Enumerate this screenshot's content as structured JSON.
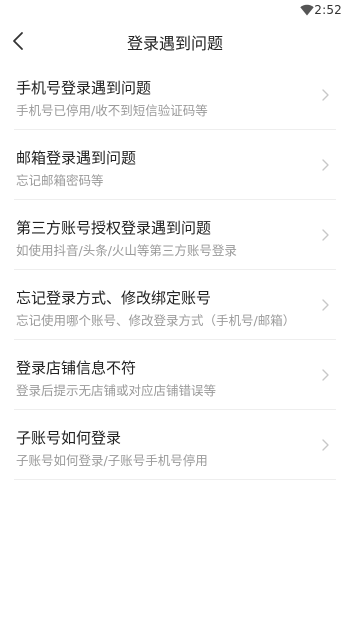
{
  "status_bar": {
    "time": "2:52",
    "icons": [
      "wifi-icon"
    ]
  },
  "header": {
    "title": "登录遇到问题",
    "back_icon": "chevron-left-icon"
  },
  "items": [
    {
      "title": "手机号登录遇到问题",
      "subtitle": "手机号已停用/收不到短信验证码等"
    },
    {
      "title": "邮箱登录遇到问题",
      "subtitle": "忘记邮箱密码等"
    },
    {
      "title": "第三方账号授权登录遇到问题",
      "subtitle": "如使用抖音/头条/火山等第三方账号登录"
    },
    {
      "title": "忘记登录方式、修改绑定账号",
      "subtitle": "忘记使用哪个账号、修改登录方式（手机号/邮箱）"
    },
    {
      "title": "登录店铺信息不符",
      "subtitle": "登录后提示无店铺或对应店铺错误等"
    },
    {
      "title": "子账号如何登录",
      "subtitle": "子账号如何登录/子账号手机号停用"
    }
  ],
  "colors": {
    "title_text": "#222222",
    "subtitle_text": "#9a9a9a",
    "divider": "#eeeeee",
    "chevron": "#c8c8c8"
  }
}
